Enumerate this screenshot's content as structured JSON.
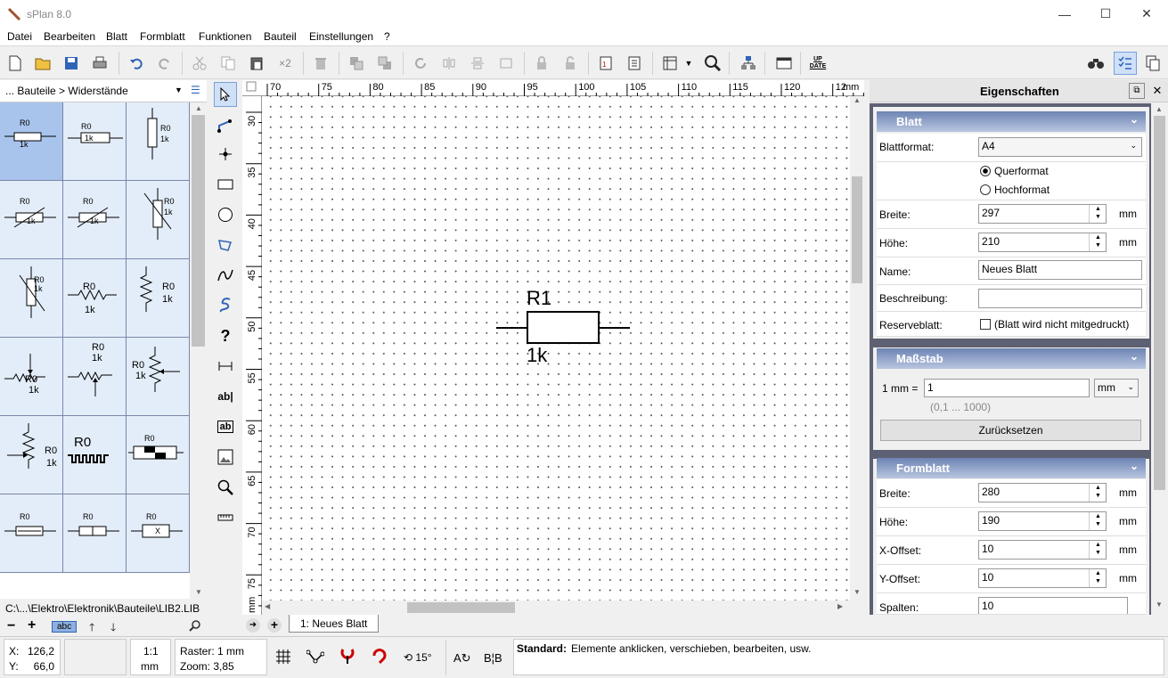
{
  "window": {
    "title": "sPlan 8.0"
  },
  "menu": [
    "Datei",
    "Bearbeiten",
    "Blatt",
    "Formblatt",
    "Funktionen",
    "Bauteil",
    "Einstellungen",
    "?"
  ],
  "library": {
    "breadcrumb": "... Bauteile > Widerstände",
    "path": "C:\\...\\Elektro\\Elektronik\\Bauteile\\LIB2.LIB",
    "abc_label": "abc",
    "cells": [
      {
        "l1": "R0",
        "l2": "1k"
      },
      {
        "l1": "R0",
        "l2": "1k"
      },
      {
        "l1": "R0",
        "l2": "1k"
      },
      {
        "l1": "R0",
        "l2": "1k"
      },
      {
        "l1": "R0",
        "l2": "1k"
      },
      {
        "l1": "R0",
        "l2": "1k"
      },
      {
        "l1": "R0",
        "l2": "1k"
      },
      {
        "l1": "R0",
        "l2": "1k"
      },
      {
        "l1": "R0",
        "l2": "1k"
      },
      {
        "l1": "R0",
        "l2": "1k"
      },
      {
        "l1": "R0",
        "l2": "1k"
      },
      {
        "l1": "R0",
        "l2": "1k"
      },
      {
        "l1": "R0",
        "l2": "1k"
      },
      {
        "l1": "R0",
        "l2": ""
      },
      {
        "l1": "R0",
        "l2": ""
      },
      {
        "l1": "R0",
        "l2": ""
      },
      {
        "l1": "R0",
        "l2": ""
      },
      {
        "l1": "R0",
        "l2": "X"
      }
    ]
  },
  "ruler": {
    "top": [
      "70",
      "75",
      "80",
      "85",
      "90",
      "95",
      "100",
      "105",
      "110",
      "115",
      "120",
      "12"
    ],
    "unit": "mm",
    "left": [
      "30",
      "35",
      "40",
      "45",
      "50",
      "55",
      "60",
      "65",
      "70",
      "75"
    ],
    "left_unit": "mm"
  },
  "component": {
    "name": "R1",
    "value": "1k"
  },
  "sheet_tab": "1: Neues Blatt",
  "props": {
    "header": "Eigenschaften",
    "blatt": {
      "title": "Blatt",
      "format_label": "Blattformat:",
      "format_value": "A4",
      "orient1": "Querformat",
      "orient2": "Hochformat",
      "breite_label": "Breite:",
      "breite": "297",
      "hoehe_label": "Höhe:",
      "hoehe": "210",
      "name_label": "Name:",
      "name": "Neues Blatt",
      "beschr_label": "Beschreibung:",
      "beschr": "",
      "reserve_label": "Reserveblatt:",
      "reserve_text": "(Blatt wird nicht mitgedruckt)",
      "unit": "mm"
    },
    "massstab": {
      "title": "Maßstab",
      "label": "1 mm =",
      "value": "1",
      "unit": "mm",
      "range": "(0,1 ... 1000)",
      "reset": "Zurücksetzen"
    },
    "formblatt": {
      "title": "Formblatt",
      "breite_label": "Breite:",
      "breite": "280",
      "hoehe_label": "Höhe:",
      "hoehe": "190",
      "xoff_label": "X-Offset:",
      "xoff": "10",
      "yoff_label": "Y-Offset:",
      "yoff": "10",
      "spalten_label": "Spalten:",
      "spalten": "10",
      "unit": "mm"
    }
  },
  "status": {
    "x_label": "X:",
    "x": "126,2",
    "y_label": "Y:",
    "y": "66,0",
    "scale": "1:1",
    "scale_unit": "mm",
    "raster": "Raster: 1 mm",
    "zoom": "Zoom: 3,85",
    "angle": "15°",
    "mode": "Standard:",
    "hint": "Elemente anklicken, verschieben, bearbeiten, usw."
  }
}
